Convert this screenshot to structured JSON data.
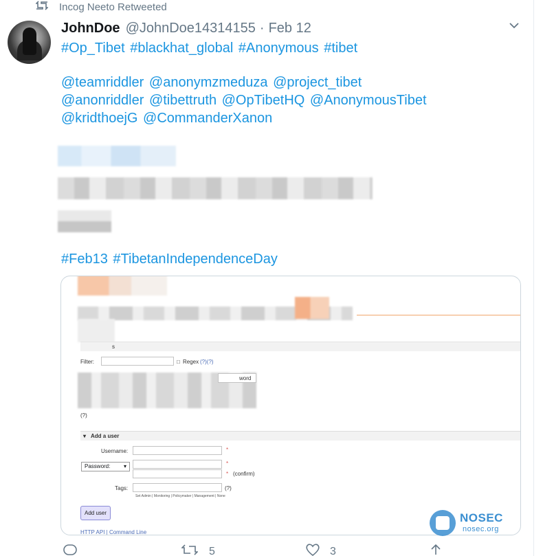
{
  "retweet_context": {
    "text": "Incog Neeto Retweeted",
    "icon": "retweet-icon"
  },
  "tweet": {
    "display_name": "JohnDoe",
    "handle": "@JohnDoe14314155",
    "separator": "·",
    "date": "Feb 12",
    "hashtags_line1": [
      "#Op_Tibet",
      "#blackhat_global",
      "#Anonymous",
      "#tibet"
    ],
    "mentions_line2": [
      "@teamriddler",
      "@anonymzmeduza",
      "@project_tibet"
    ],
    "mentions_line3": [
      "@anonriddler",
      "@tibettruth",
      "@OpTibetHQ",
      "@AnonymousTibet"
    ],
    "mentions_line4": [
      "@kridthoejG",
      "@CommanderXanon"
    ],
    "hashtags_line5": [
      "#Feb13",
      "#TibetanIndependenceDay"
    ]
  },
  "media": {
    "section_suffix": "s",
    "filter_label": "Filter:",
    "regex_label": "Regex",
    "regex_help": "(?)(?)",
    "password_button_fragment": "word",
    "bracket_help": "(?)",
    "add_user_section": "Add a user",
    "username_label": "Username:",
    "password_select": "Password:",
    "confirm_label": "(confirm)",
    "tags_label": "Tags:",
    "tags_help": "(?)",
    "tag_options": "Set   Admin | Monitoring | Policymaker | Management | None",
    "add_user_button": "Add user",
    "footer_links": "HTTP API  |  Command Line",
    "required_mark": "*"
  },
  "watermark": {
    "brand": "NOSEC",
    "site": "nosec.org"
  },
  "actions": {
    "reply_count": "",
    "retweet_count": "5",
    "like_count": "3"
  },
  "colors": {
    "link": "#1b95e0",
    "muted": "#657786",
    "accent_orange": "#f0a66a"
  }
}
